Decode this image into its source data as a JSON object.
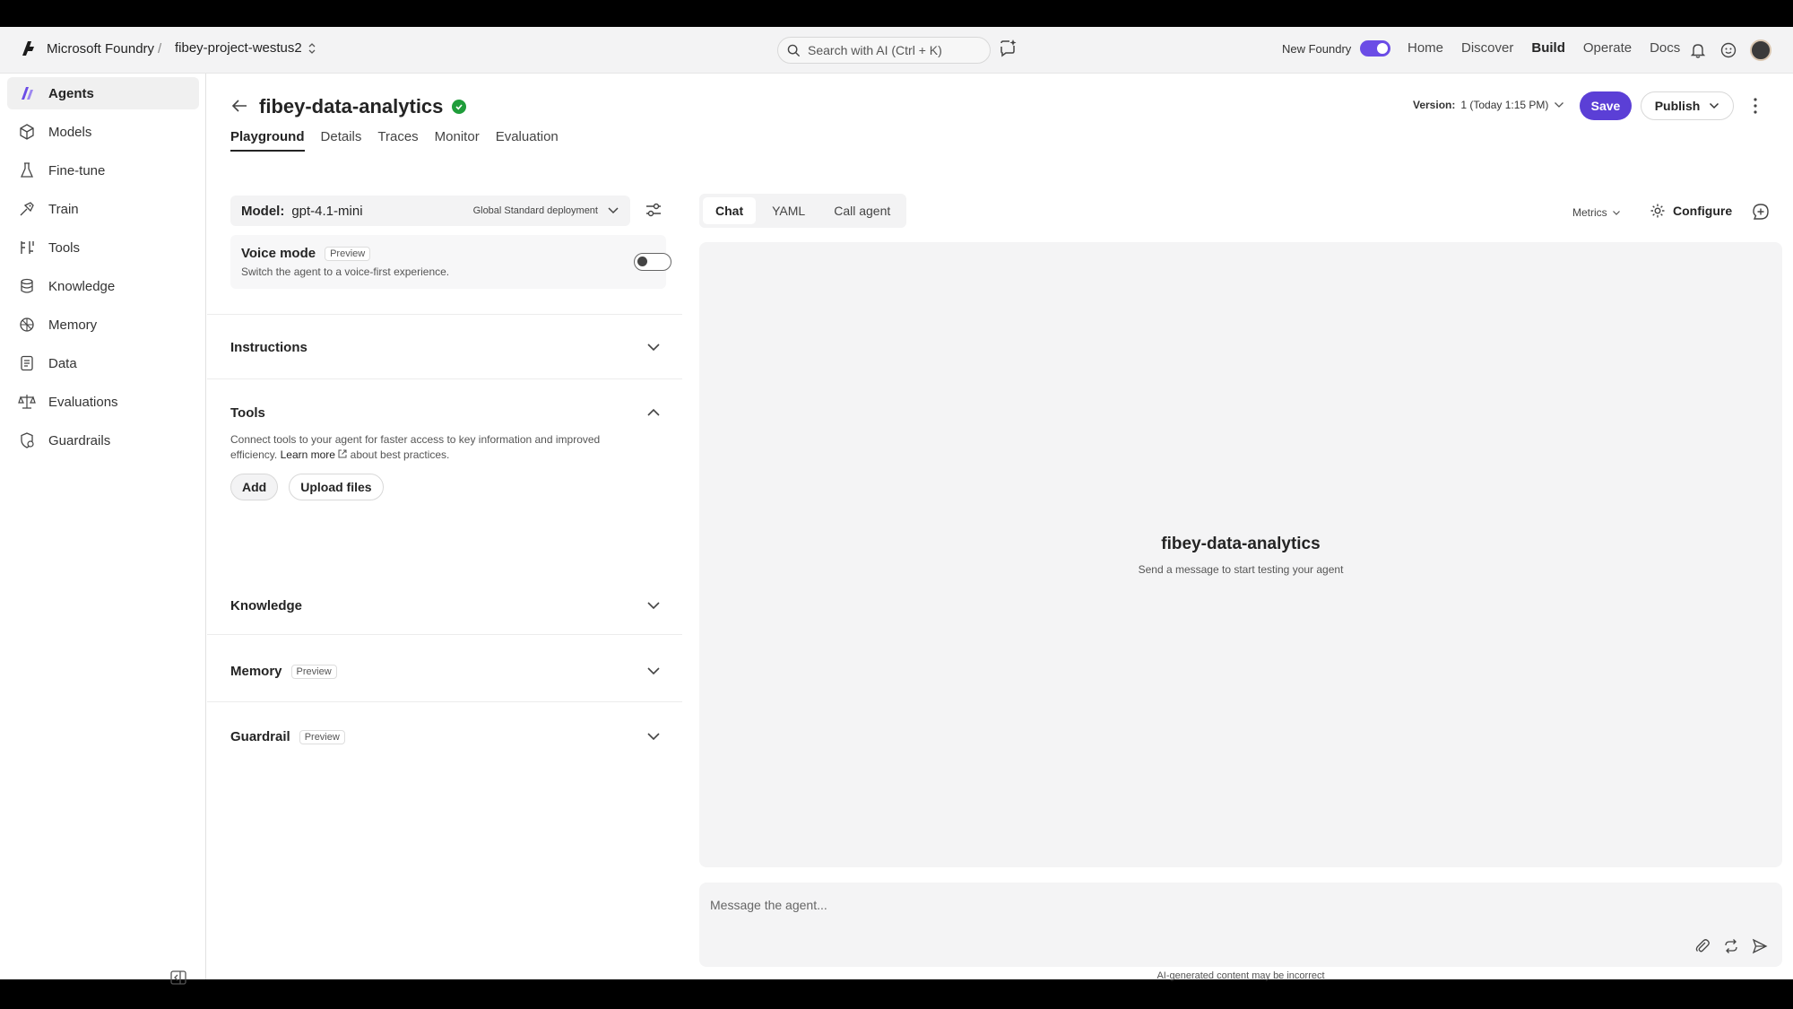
{
  "app": {
    "brand": "Microsoft Foundry",
    "project": "fibey-project-westus2",
    "search_placeholder": "Search with AI (Ctrl + K)",
    "new_foundry_label": "New Foundry",
    "nav": [
      "Home",
      "Discover",
      "Build",
      "Operate",
      "Docs"
    ],
    "nav_active": "Build",
    "accent_color": "#5b3fd6"
  },
  "sidebar": {
    "items": [
      {
        "label": "Agents",
        "icon": "agents-icon"
      },
      {
        "label": "Models",
        "icon": "models-icon"
      },
      {
        "label": "Fine-tune",
        "icon": "flask-icon"
      },
      {
        "label": "Train",
        "icon": "train-icon"
      },
      {
        "label": "Tools",
        "icon": "tools-icon"
      },
      {
        "label": "Knowledge",
        "icon": "knowledge-icon"
      },
      {
        "label": "Memory",
        "icon": "memory-icon"
      },
      {
        "label": "Data",
        "icon": "data-icon"
      },
      {
        "label": "Evaluations",
        "icon": "scale-icon"
      },
      {
        "label": "Guardrails",
        "icon": "shield-icon"
      }
    ]
  },
  "agent": {
    "name": "fibey-data-analytics",
    "tabs": [
      "Playground",
      "Details",
      "Traces",
      "Monitor",
      "Evaluation"
    ],
    "active_tab": "Playground"
  },
  "model": {
    "label": "Model:",
    "value": "gpt-4.1-mini",
    "deployment": "Global Standard deployment"
  },
  "voice": {
    "title": "Voice mode",
    "badge": "Preview",
    "description": "Switch the agent to a voice-first experience."
  },
  "sections": {
    "instructions": "Instructions",
    "tools": "Tools",
    "tools_desc_1": "Connect tools to your agent for faster access to key information and improved efficiency.",
    "tools_learn_more": "Learn more",
    "tools_desc_2": "about best practices.",
    "add_button": "Add",
    "upload_button": "Upload files",
    "knowledge": "Knowledge",
    "memory": "Memory",
    "memory_badge": "Preview",
    "guardrail": "Guardrail",
    "guardrail_badge": "Preview"
  },
  "header": {
    "version_label": "Version:",
    "version_value": "1 (Today 1:15 PM)",
    "save": "Save",
    "publish": "Publish"
  },
  "chat": {
    "tabs": [
      "Chat",
      "YAML",
      "Call agent"
    ],
    "active_tab": "Chat",
    "metrics": "Metrics",
    "configure": "Configure",
    "empty_title": "fibey-data-analytics",
    "empty_subtitle": "Send a message to start testing your agent",
    "input_placeholder": "Message the agent...",
    "disclaimer": "AI-generated content may be incorrect"
  }
}
